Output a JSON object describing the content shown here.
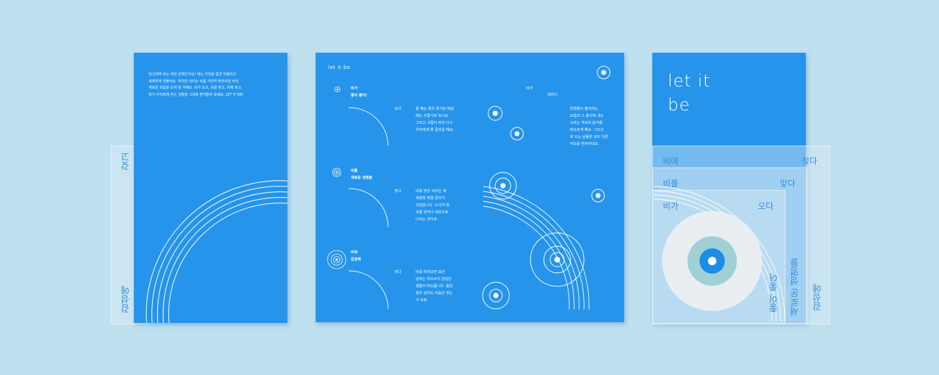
{
  "left_leaflet": {
    "paragraph": "당신에게 비는 어떤 존재인가요? 비는 우리를 힘껏 우울하고\n축축하게 만들어요. 하지만 내리는 비를 가만히 바라보면 비의\n새로운 모습을 보게 될 거예요. 비가 오고, 비를 맞고, 비에 젖고,\n비가 우리에게 주는 것들을 그대로 받아들여 보세요. LET IT BE!",
    "back_label_top": "갖고",
    "back_label_bottom": "감성에"
  },
  "center_spread": {
    "brand": "let it be",
    "sections": [
      {
        "title": "비가\n좋아 좋아!",
        "verb": "오다",
        "body": "둘 쨰는 꽃은 꽃기린 피날\n때는 수줍기로 피나요.\n그러고 구름이 되어 다시\n우리에게 좋 준비를 해요."
      },
      {
        "title": "비를\n새로운 생명을",
        "verb": "맞다",
        "body": "비를 맞은 씨앗은 새\n새생명 맞을 준비가\n되었습니다. 드디어 땅\n속을 벗어나 세상으로\n나오는 것이죠."
      },
      {
        "title": "비에\n감성에",
        "verb": "젖다",
        "body": "비를 바라보면 묘은\n날에는 떠오르지 않았던\n생들이 떠오릅니다. 동은\n정지 않아도 마음은 젖는\n거 죠죠."
      }
    ],
    "right_top_a": "비가",
    "right_top_b": "내리다",
    "right_body": "빗방울이 떨어지는\n모습과 그 용사에 내는\n소리는 악보와 음악을\n떠오르게 해요. 그리고\n비 오는 날들은 모두 다른\n악보를 연주하네요."
  },
  "right_leaflet": {
    "title_line1": "let it",
    "title_line2": "be",
    "rows": [
      {
        "left": "비에",
        "right": "젖다"
      },
      {
        "left": "비를",
        "right": "맞다"
      },
      {
        "left": "비가",
        "right": "오다"
      }
    ],
    "vertical_labels": [
      "좋이 좋아",
      "새로운 생명을",
      "감성에"
    ]
  },
  "colors": {
    "background": "#bfe0ef",
    "primary_blue": "#2694ea",
    "white": "#ffffff",
    "label_blue": "#2f8fe0"
  }
}
